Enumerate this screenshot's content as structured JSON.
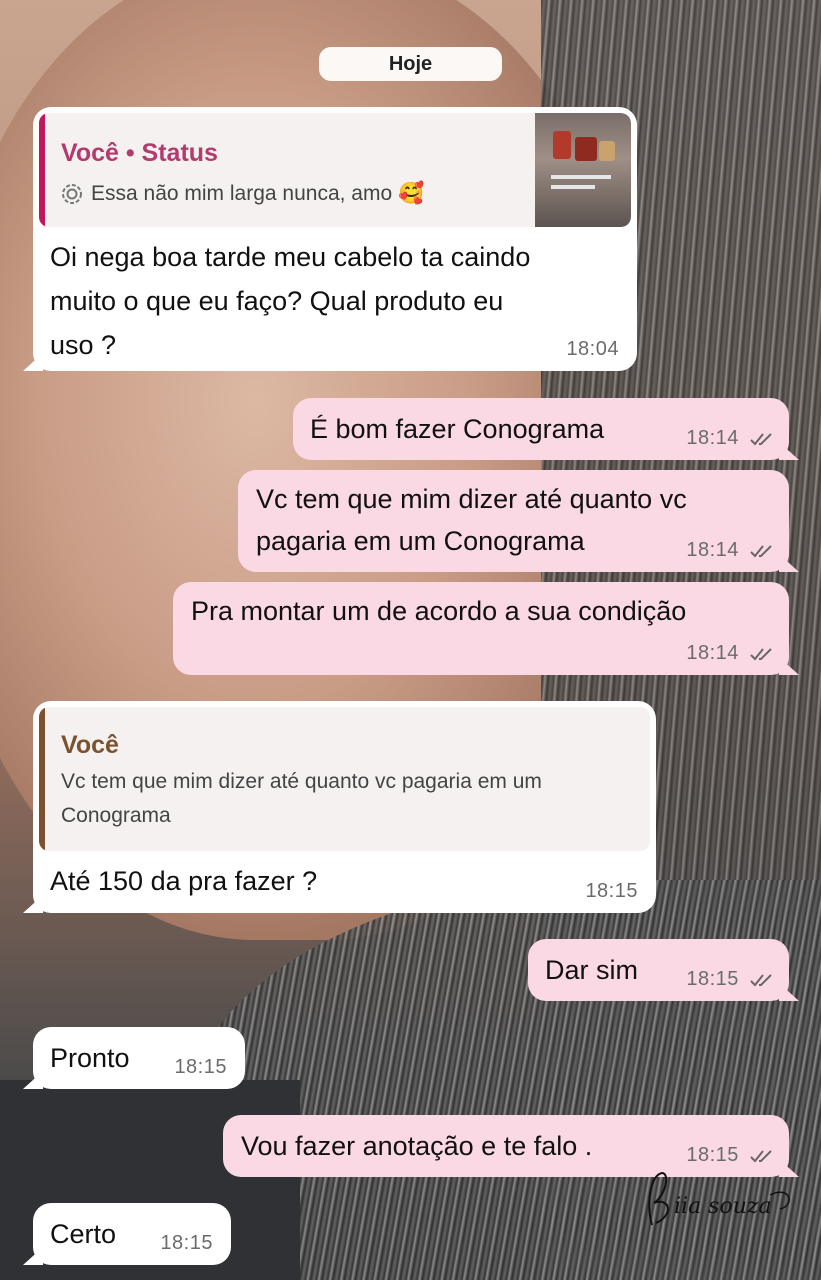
{
  "day_label": "Hoje",
  "messages": [
    {
      "direction": "incoming",
      "reply": {
        "author": "Você • Status",
        "status_text": "Essa não mim larga nunca, amo 🥰"
      },
      "text_lines": [
        "Oi nega boa tarde meu cabelo ta caindo",
        "muito o que eu faço? Qual produto eu",
        "uso ?"
      ],
      "time": "18:04"
    },
    {
      "direction": "outgoing",
      "text_lines": [
        "É bom fazer Conograma"
      ],
      "time": "18:14"
    },
    {
      "direction": "outgoing",
      "text_lines": [
        "Vc tem que mim dizer até quanto vc",
        "pagaria em um Conograma"
      ],
      "time": "18:14"
    },
    {
      "direction": "outgoing",
      "text_lines": [
        "Pra montar um de acordo a sua condição"
      ],
      "time": "18:14"
    },
    {
      "direction": "incoming",
      "reply": {
        "author": "Você",
        "text_lines": [
          "Vc tem que mim dizer até quanto vc pagaria em um",
          "Conograma"
        ]
      },
      "text_lines": [
        "Até 150 da pra fazer ?"
      ],
      "time": "18:15"
    },
    {
      "direction": "outgoing",
      "text_lines": [
        "Dar sim"
      ],
      "time": "18:15"
    },
    {
      "direction": "incoming",
      "text_lines": [
        "Pronto"
      ],
      "time": "18:15"
    },
    {
      "direction": "outgoing",
      "text_lines": [
        "Vou fazer anotação e te falo ."
      ],
      "time": "18:15"
    },
    {
      "direction": "incoming",
      "text_lines": [
        "Certo"
      ],
      "time": "18:15"
    }
  ],
  "watermark": "Biia souza",
  "colors": {
    "incoming_bubble": "#ffffff",
    "outgoing_bubble": "#fbd9e4",
    "status_reply_accent": "#c2185b",
    "reply_accent": "#7a5230",
    "status_author_color": "#b23a6e",
    "reply_author_color": "#7a5230"
  },
  "icons": {
    "read_receipt": "double-check-icon",
    "status_reply": "status-ring-icon"
  }
}
